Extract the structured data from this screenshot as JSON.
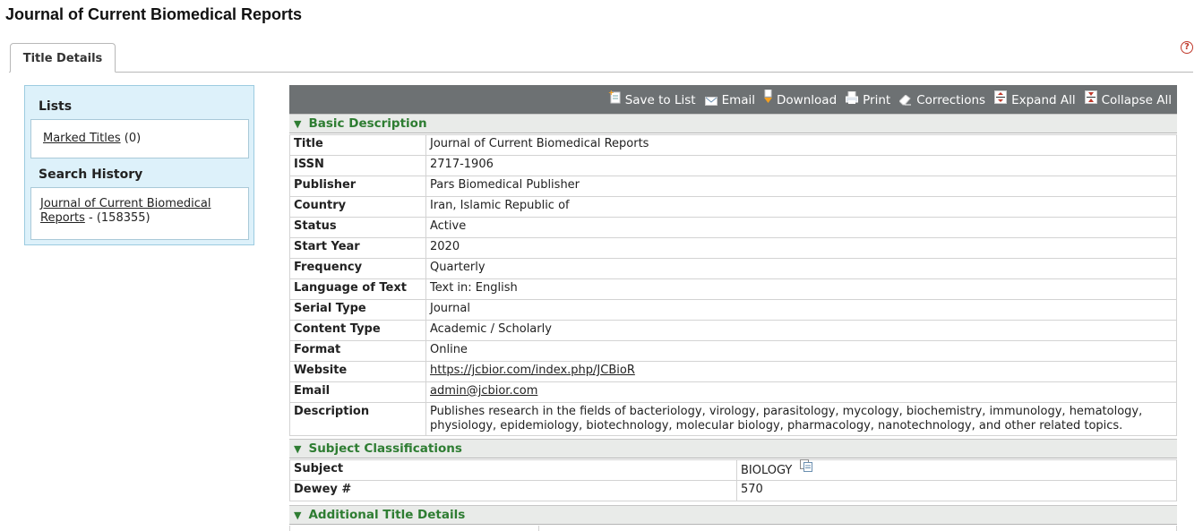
{
  "page": {
    "title": "Journal of Current Biomedical Reports"
  },
  "tabs": [
    {
      "label": "Title Details"
    }
  ],
  "help": {
    "glyph": "?"
  },
  "sidebar": {
    "lists_heading": "Lists",
    "marked_titles_link": "Marked Titles",
    "marked_titles_count": "(0)",
    "search_history_heading": "Search History",
    "history_link": "Journal of Current Biomedical Reports",
    "history_count": "- (158355)"
  },
  "toolbar": {
    "save_to_list": "Save to List",
    "email": "Email",
    "download": "Download",
    "print": "Print",
    "corrections": "Corrections",
    "expand_all": "Expand All",
    "collapse_all": "Collapse All"
  },
  "sections": {
    "basic": "Basic Description",
    "subject": "Subject Classifications",
    "additional": "Additional Title Details",
    "arrow": "▼"
  },
  "basic_rows": [
    {
      "label": "Title",
      "value": "Journal of Current Biomedical Reports"
    },
    {
      "label": "ISSN",
      "value": "2717-1906"
    },
    {
      "label": "Publisher",
      "value": "Pars Biomedical Publisher"
    },
    {
      "label": "Country",
      "value": "Iran, Islamic Republic of"
    },
    {
      "label": "Status",
      "value": "Active"
    },
    {
      "label": "Start Year",
      "value": "2020"
    },
    {
      "label": "Frequency",
      "value": "Quarterly"
    },
    {
      "label": "Language of Text",
      "value": "Text in: English"
    },
    {
      "label": "Serial Type",
      "value": "Journal"
    },
    {
      "label": "Content Type",
      "value": "Academic / Scholarly"
    },
    {
      "label": "Format",
      "value": "Online"
    },
    {
      "label": "Website",
      "value": "https://jcbior.com/index.php/JCBioR"
    },
    {
      "label": "Email",
      "value": "admin@jcbior.com"
    },
    {
      "label": "Description",
      "value": "Publishes research in the fields of bacteriology, virology, parasitology, mycology, biochemistry, immunology, hematology, physiology, epidemiology, biotechnology, molecular biology, pharmacology, nanotechnology, and other related topics."
    }
  ],
  "subject_rows": [
    {
      "label": "Subject",
      "value": "BIOLOGY"
    },
    {
      "label": "Dewey #",
      "value": "570"
    }
  ],
  "colors": {
    "toolbar_bg": "#6d7173",
    "section_text": "#2e7d32",
    "sidebar_bg": "#ddf1fa",
    "help": "#c0392b"
  }
}
